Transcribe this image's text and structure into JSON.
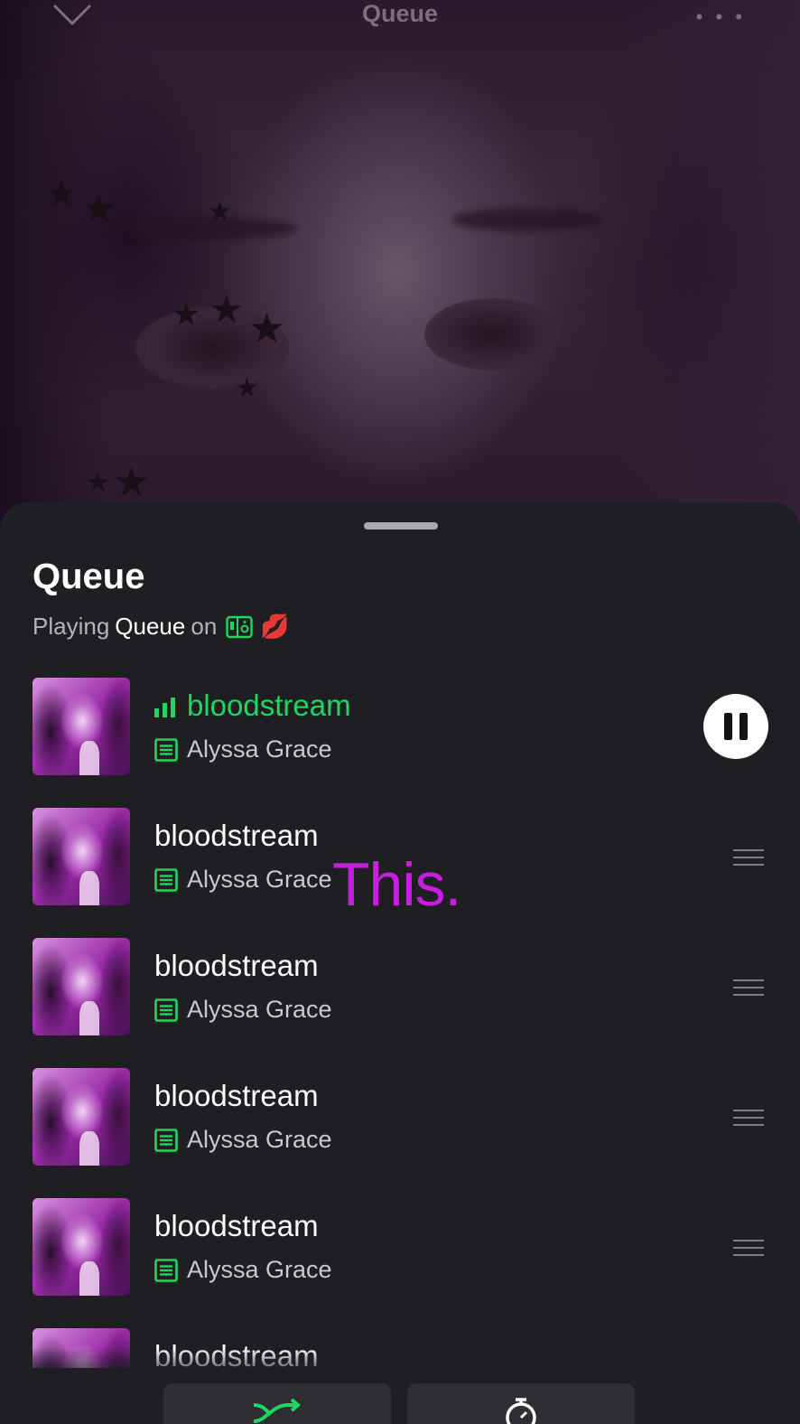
{
  "header": {
    "title": "Queue",
    "more_label": "• • •"
  },
  "sheet": {
    "title": "Queue",
    "subtitle_prefix": "Playing",
    "subtitle_source": "Queue",
    "subtitle_on": "on",
    "device_emoji": "💋"
  },
  "now_playing": {
    "title": "bloodstream",
    "artist": "Alyssa Grace"
  },
  "queue": [
    {
      "title": "bloodstream",
      "artist": "Alyssa Grace"
    },
    {
      "title": "bloodstream",
      "artist": "Alyssa Grace"
    },
    {
      "title": "bloodstream",
      "artist": "Alyssa Grace"
    },
    {
      "title": "bloodstream",
      "artist": "Alyssa Grace"
    },
    {
      "title": "bloodstream",
      "artist": "Alyssa Grace"
    }
  ],
  "overlay": {
    "text": "This."
  },
  "icons": {
    "collapse": "chevron-down-icon",
    "more": "more-dots-icon",
    "playing": "equalizer-icon",
    "lyrics": "lyrics-icon",
    "device": "speaker-device-icon",
    "pause": "pause-icon",
    "drag": "drag-handle-icon",
    "shuffle": "shuffle-icon",
    "timer": "sleep-timer-icon"
  },
  "colors": {
    "accent": "#1ed760",
    "overlay": "#c51fe0",
    "sheet_bg": "#1f1e23"
  }
}
